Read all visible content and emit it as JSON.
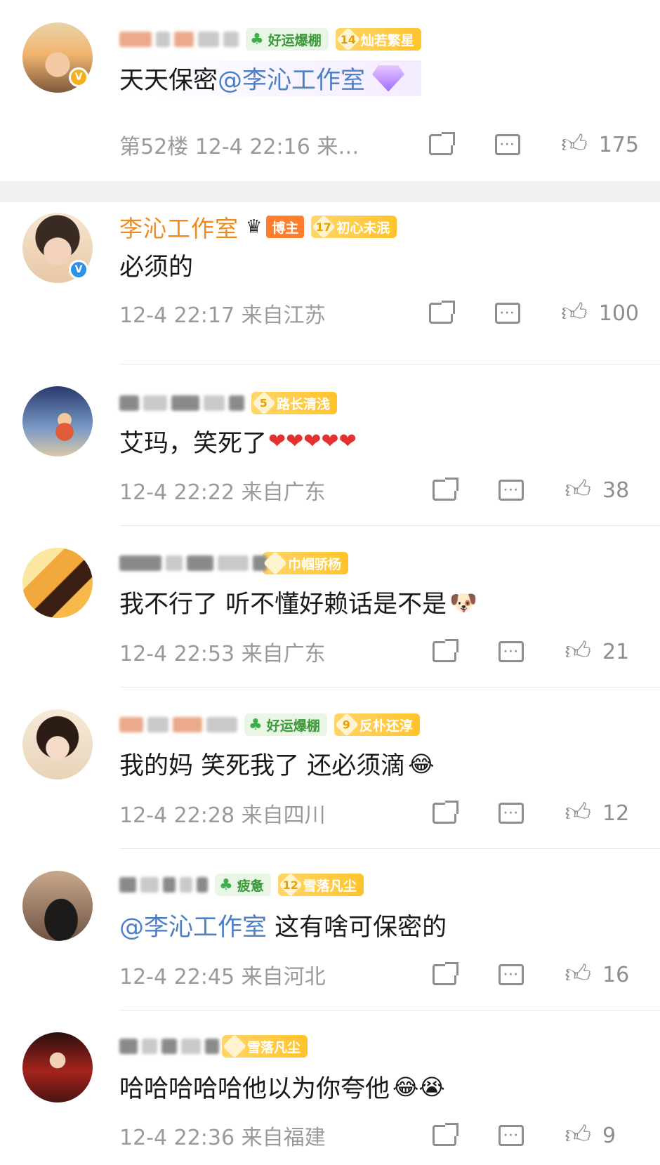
{
  "comments": [
    {
      "badges": [
        {
          "text": "好运爆棚"
        },
        {
          "level": "14",
          "text": "灿若繁星"
        }
      ],
      "content_plain": "天天保密",
      "content_mention": "@李沁工作室",
      "meta": "第52楼 12-4 22:16 来…",
      "likes": "175"
    },
    {
      "username": "李沁工作室",
      "badges": [
        {
          "text": "博主"
        },
        {
          "level": "17",
          "text": "初心未泯"
        }
      ],
      "content": "必须的",
      "meta": "12-4 22:17 来自江苏",
      "likes": "100"
    },
    {
      "badges": [
        {
          "level": "5",
          "text": "路长清浅"
        }
      ],
      "content": "艾玛，笑死了",
      "meta": "12-4 22:22 来自广东",
      "likes": "38"
    },
    {
      "badges": [
        {
          "text": "巾帼骄杨"
        }
      ],
      "content": "我不行了 听不懂好赖话是不是",
      "meta": "12-4 22:53 来自广东",
      "likes": "21"
    },
    {
      "badges": [
        {
          "text": "好运爆棚"
        },
        {
          "level": "9",
          "text": "反朴还淳"
        }
      ],
      "content": "我的妈 笑死我了 还必须滴",
      "meta": "12-4 22:28 来自四川",
      "likes": "12"
    },
    {
      "badges": [
        {
          "text": "疲惫"
        },
        {
          "level": "12",
          "text": "雪落凡尘"
        }
      ],
      "content_mention": "@李沁工作室",
      "content_plain": " 这有啥可保密的",
      "meta": "12-4 22:45 来自河北",
      "likes": "16"
    },
    {
      "badges": [
        {
          "text": "雪落凡尘"
        }
      ],
      "content": "哈哈哈哈哈他以为你夸他",
      "meta": "12-4 22:36 来自福建",
      "likes": "9"
    }
  ],
  "icons": [
    "share-icon",
    "comment-icon",
    "like-icon",
    "verified-icon",
    "clover-icon",
    "crown-icon",
    "gem-icon"
  ],
  "colors": {
    "username": "#f08a1c",
    "mention": "#4d7fc7",
    "meta": "#9a9a9a",
    "divider_band": "#f0f0f0"
  }
}
